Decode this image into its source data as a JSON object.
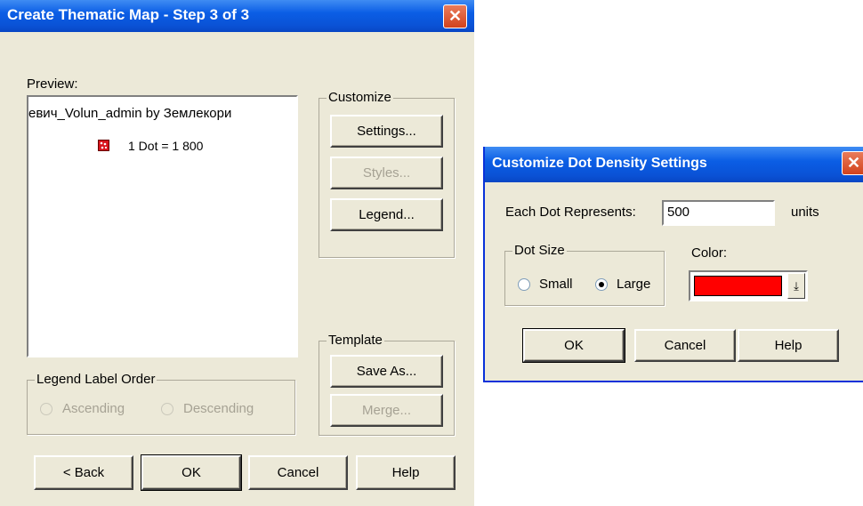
{
  "wizard": {
    "title": "Create Thematic Map - Step 3 of 3",
    "preview_label": "Preview:",
    "preview_layer_title": "евич_Volun_admin by Землекори",
    "preview_legend_text": "1 Dot = 1 800",
    "customize": {
      "legend": "Customize",
      "settings_label": "Settings...",
      "styles_label": "Styles...",
      "legend_label": "Legend..."
    },
    "template": {
      "legend": "Template",
      "save_as_label": "Save As...",
      "merge_label": "Merge..."
    },
    "legend_label_order": {
      "legend": "Legend Label Order",
      "ascending_label": "Ascending",
      "descending_label": "Descending"
    },
    "buttons": {
      "back_label": "< Back",
      "ok_label": "OK",
      "cancel_label": "Cancel",
      "help_label": "Help"
    }
  },
  "dot_density": {
    "title": "Customize Dot Density Settings",
    "each_dot_label": "Each Dot Represents:",
    "each_dot_value": "500",
    "units_label": "units",
    "dot_size_legend": "Dot Size",
    "small_label": "Small",
    "large_label": "Large",
    "selected_size": "Large",
    "color_label": "Color:",
    "color_value": "#ff0000",
    "buttons": {
      "ok_label": "OK",
      "cancel_label": "Cancel",
      "help_label": "Help"
    }
  },
  "colors": {
    "title_bar": "#0a52d6",
    "dialog_face": "#ece9d8",
    "dot_color": "#ff0000"
  }
}
